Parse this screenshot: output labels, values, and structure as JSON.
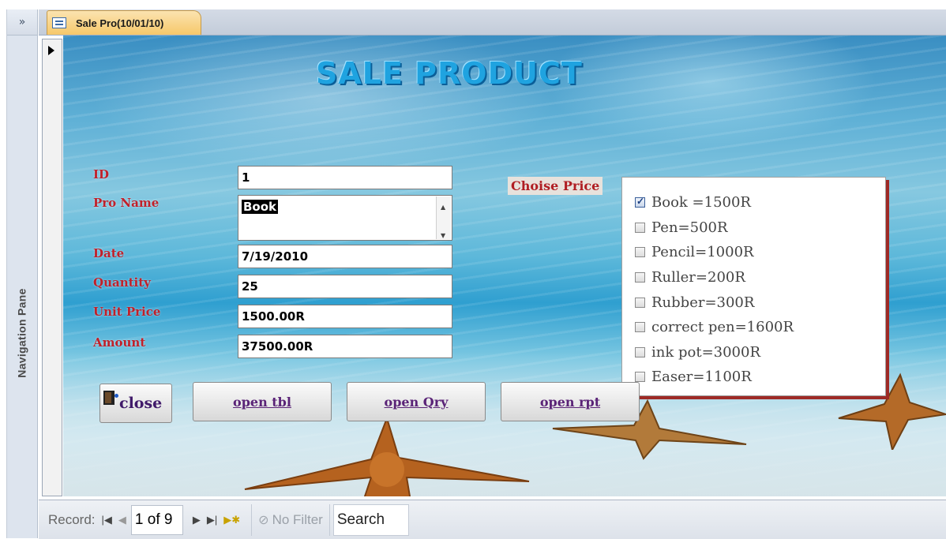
{
  "nav_pane": {
    "toggle_icon": "»",
    "label": "Navigation Pane"
  },
  "tab": {
    "title": "Sale Pro(10/01/10)"
  },
  "form": {
    "title": "SALE PRODUCT",
    "fields": {
      "id": {
        "label": "ID",
        "value": "1"
      },
      "pro_name": {
        "label": "Pro Name",
        "value": "Book"
      },
      "date": {
        "label": "Date",
        "value": "7/19/2010"
      },
      "quantity": {
        "label": "Quantity",
        "value": "25"
      },
      "unit_price": {
        "label": "Unit Price",
        "value": "1500.00R"
      },
      "amount": {
        "label": "Amount",
        "value": "37500.00R"
      }
    },
    "choise_price": {
      "label": "Choise Price",
      "options": [
        {
          "label": "Book =1500R",
          "checked": true
        },
        {
          "label": "Pen=500R",
          "checked": false
        },
        {
          "label": "Pencil=1000R",
          "checked": false
        },
        {
          "label": "Ruller=200R",
          "checked": false
        },
        {
          "label": "Rubber=300R",
          "checked": false
        },
        {
          "label": "correct pen=1600R",
          "checked": false
        },
        {
          "label": "ink pot=3000R",
          "checked": false
        },
        {
          "label": "Easer=1100R",
          "checked": false
        }
      ]
    },
    "buttons": {
      "close": "close",
      "open_tbl": "open tbl",
      "open_qry": "open Qry",
      "open_rpt": "open rpt"
    }
  },
  "statusbar": {
    "record_label": "Record:",
    "position": "1 of 9",
    "filter_label": "No Filter",
    "search_label": "Search"
  },
  "icons": {
    "nav_toggle": "double-chevron-right-icon",
    "tab": "form-icon",
    "close": "exit-door-icon",
    "filter": "no-filter-icon"
  }
}
